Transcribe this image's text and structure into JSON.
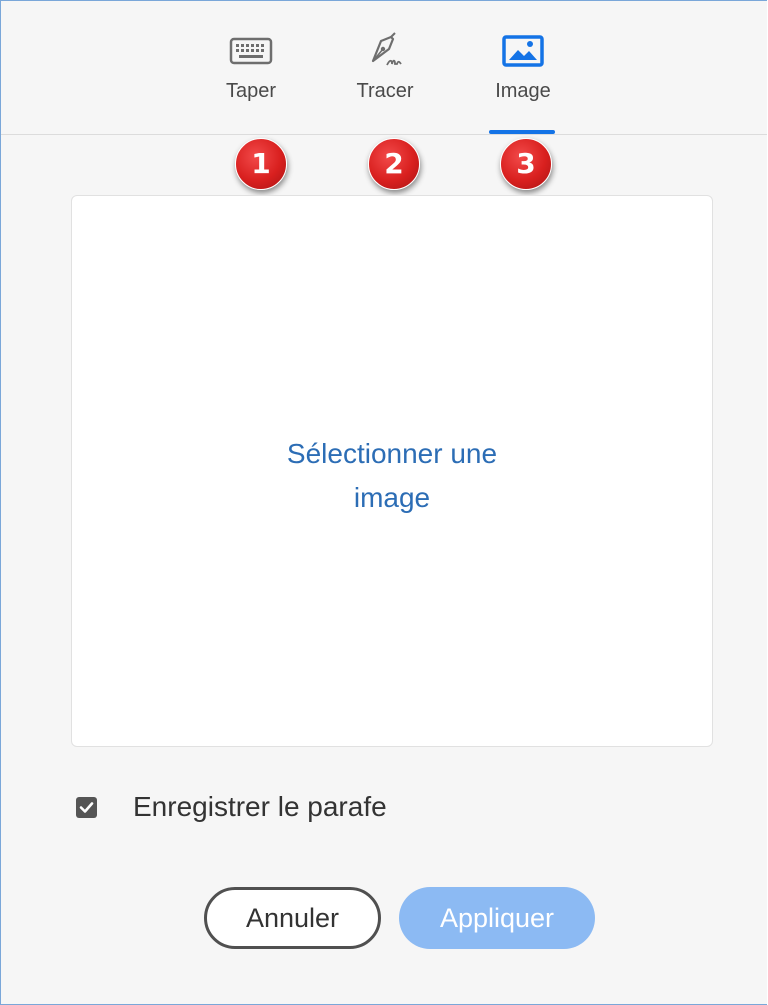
{
  "tabs": [
    {
      "label": "Taper",
      "icon": "keyboard-icon"
    },
    {
      "label": "Tracer",
      "icon": "pen-signature-icon"
    },
    {
      "label": "Image",
      "icon": "image-icon",
      "selected": true
    }
  ],
  "badges": [
    "1",
    "2",
    "3"
  ],
  "drop_area": {
    "select_line1": "Sélectionner une",
    "select_line2": "image"
  },
  "save_option": {
    "label": "Enregistrer le parafe",
    "checked": true
  },
  "buttons": {
    "cancel": "Annuler",
    "apply": "Appliquer"
  },
  "colors": {
    "accent": "#1473e6",
    "link": "#2c6db5",
    "apply_disabled": "#8cbaf3",
    "badge": "#d9201f"
  }
}
